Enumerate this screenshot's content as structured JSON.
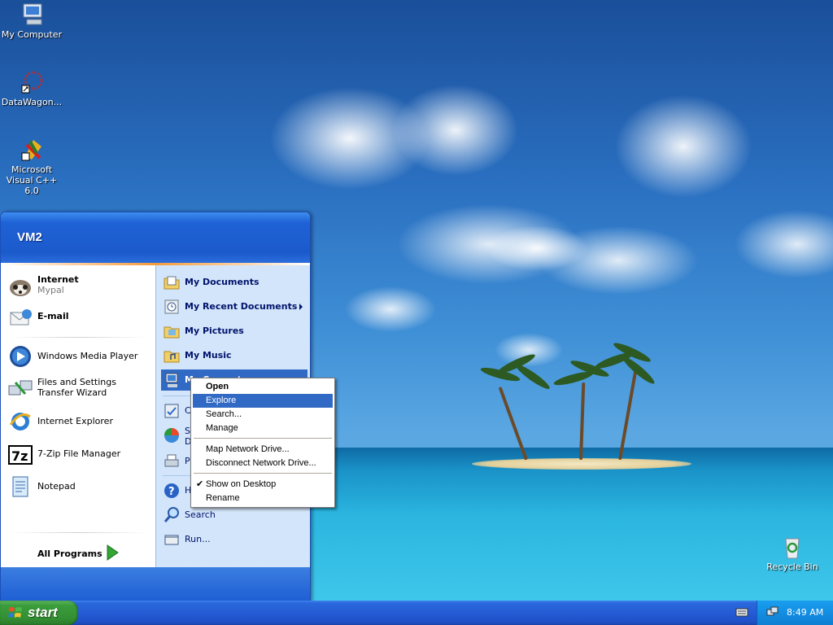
{
  "desktop": {
    "icons": [
      {
        "label": "My Computer",
        "icon": "my-computer-icon"
      },
      {
        "label": "DataWagon...",
        "icon": "datawagon-icon"
      },
      {
        "label": "Microsoft Visual C++ 6.0",
        "icon": "visual-cpp-icon"
      },
      {
        "label": "Recycle Bin",
        "icon": "recycle-bin-icon"
      }
    ]
  },
  "start_menu": {
    "user": "VM2",
    "left": {
      "pinned": [
        {
          "label": "Internet",
          "sub": "Mypal",
          "icon": "mypal-browser-icon"
        },
        {
          "label": "E-mail",
          "icon": "email-icon"
        }
      ],
      "recent": [
        {
          "label": "Windows Media Player",
          "icon": "media-player-icon"
        },
        {
          "label": "Files and Settings Transfer Wizard",
          "icon": "transfer-wizard-icon"
        },
        {
          "label": "Internet Explorer",
          "icon": "internet-explorer-icon"
        },
        {
          "label": "7-Zip File Manager",
          "icon": "7zip-icon"
        },
        {
          "label": "Notepad",
          "icon": "notepad-icon"
        }
      ],
      "all_programs": "All Programs"
    },
    "right": {
      "items": [
        {
          "label": "My Documents",
          "icon": "documents-folder-icon"
        },
        {
          "label": "My Recent Documents",
          "icon": "recent-documents-icon"
        },
        {
          "label": "My Pictures",
          "icon": "pictures-folder-icon"
        },
        {
          "label": "My Music",
          "icon": "music-folder-icon"
        },
        {
          "label": "My Computer",
          "icon": "my-computer-icon"
        },
        {
          "label": "C",
          "icon": "control-panel-icon"
        },
        {
          "label": "Se",
          "icon": "set-program-access-icon"
        },
        {
          "label": "Pr",
          "icon": "printers-icon"
        },
        {
          "label": "H",
          "icon": "help-icon"
        },
        {
          "label": "Search",
          "icon": "search-icon"
        },
        {
          "label": "Run...",
          "icon": "run-icon"
        }
      ],
      "partial_labels": {
        "se_line2": "D"
      }
    }
  },
  "context_menu": {
    "items": [
      {
        "label": "Open",
        "bold": true
      },
      {
        "label": "Explore",
        "highlighted": true
      },
      {
        "label": "Search..."
      },
      {
        "label": "Manage"
      },
      {
        "label": "Map Network Drive..."
      },
      {
        "label": "Disconnect Network Drive..."
      },
      {
        "label": "Show on Desktop",
        "checked": true
      },
      {
        "label": "Rename"
      }
    ]
  },
  "taskbar": {
    "start_label": "start",
    "clock": "8:49 AM"
  },
  "colors": {
    "start_green": "#3b9c3b",
    "taskbar_blue": "#2459d3",
    "highlight": "#316ac5",
    "right_pane": "#d3e5fa"
  }
}
